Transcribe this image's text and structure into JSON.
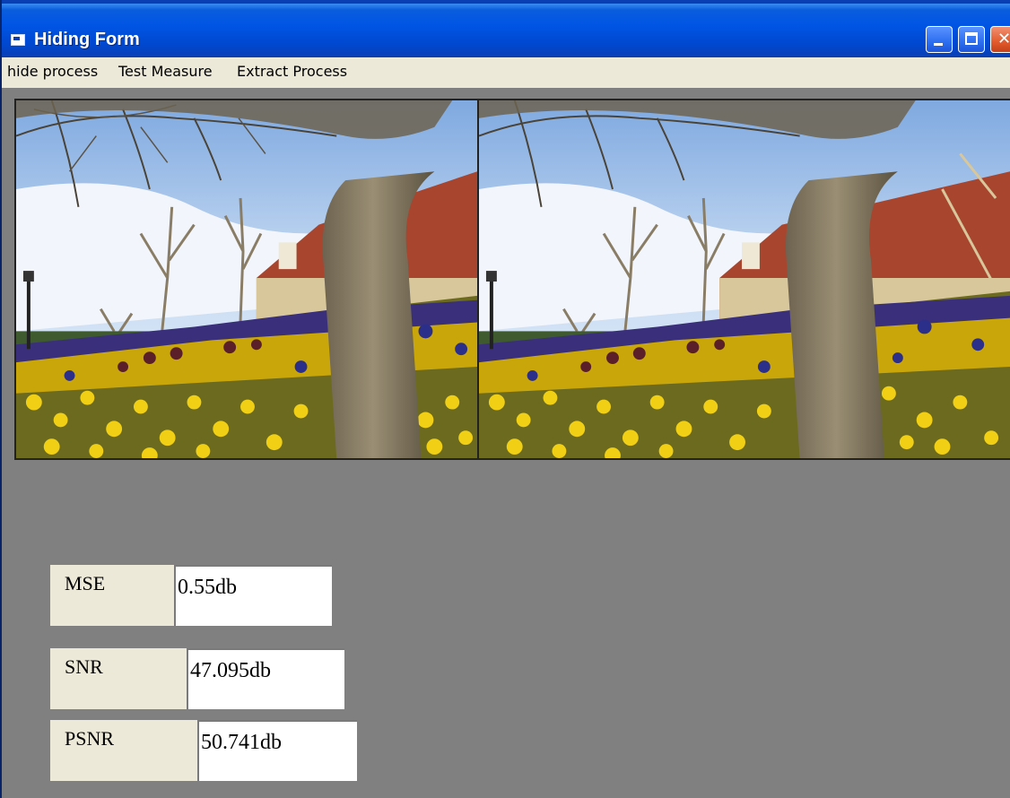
{
  "window": {
    "title": "Hiding Form"
  },
  "menu": {
    "items": [
      "hide process",
      "Test Measure",
      "Extract Process"
    ]
  },
  "images": {
    "original": "original-flower-garden-image",
    "stego": "stego-flower-garden-image"
  },
  "measures": {
    "mse": {
      "label": "MSE",
      "value": "0.55db"
    },
    "snr": {
      "label": "SNR",
      "value": "47.095db"
    },
    "psnr": {
      "label": "PSNR",
      "value": "50.741db"
    }
  },
  "colors": {
    "titlebar": "#0055e5",
    "client_background": "#808080",
    "menubar": "#ece9d8",
    "close_button": "#e35a2c"
  }
}
